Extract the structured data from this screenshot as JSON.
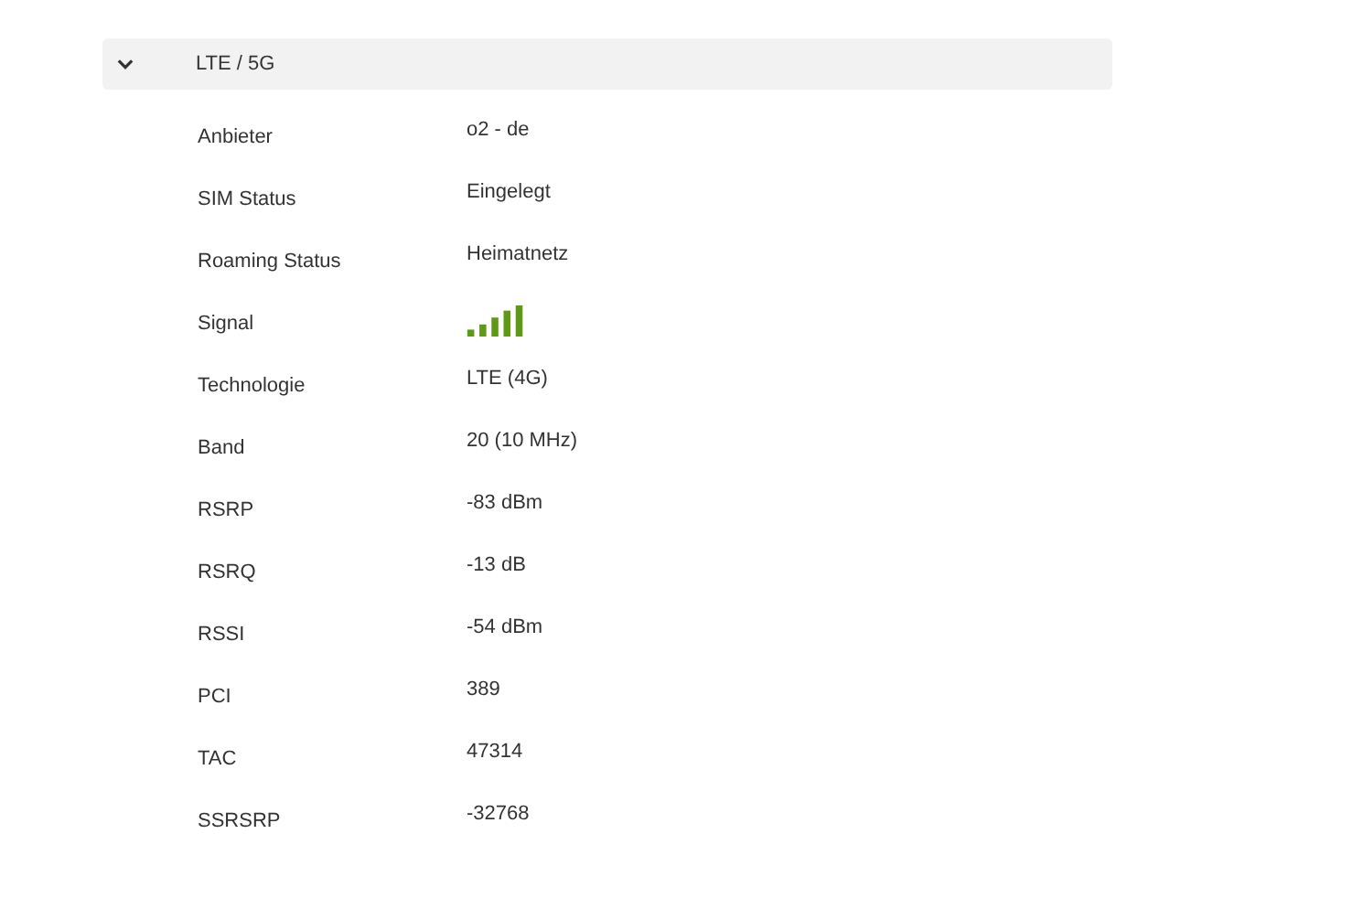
{
  "section": {
    "title": "LTE / 5G",
    "expanded": true,
    "rows": [
      {
        "label": "Anbieter",
        "kind": "text",
        "value": "o2 - de"
      },
      {
        "label": "SIM Status",
        "kind": "text",
        "value": "Eingelegt"
      },
      {
        "label": "Roaming Status",
        "kind": "text",
        "value": "Heimatnetz"
      },
      {
        "label": "Signal",
        "kind": "signal"
      },
      {
        "label": "Technologie",
        "kind": "text",
        "value": "LTE (4G)"
      },
      {
        "label": "Band",
        "kind": "text",
        "value": "20 (10 MHz)"
      },
      {
        "label": "RSRP",
        "kind": "text",
        "value": "-83 dBm"
      },
      {
        "label": "RSRQ",
        "kind": "text",
        "value": "-13 dB"
      },
      {
        "label": "RSSI",
        "kind": "text",
        "value": "-54 dBm"
      },
      {
        "label": "PCI",
        "kind": "text",
        "value": "389"
      },
      {
        "label": "TAC",
        "kind": "text",
        "value": "47314"
      },
      {
        "label": "SSRSRP",
        "kind": "text",
        "value": "-32768"
      }
    ]
  }
}
